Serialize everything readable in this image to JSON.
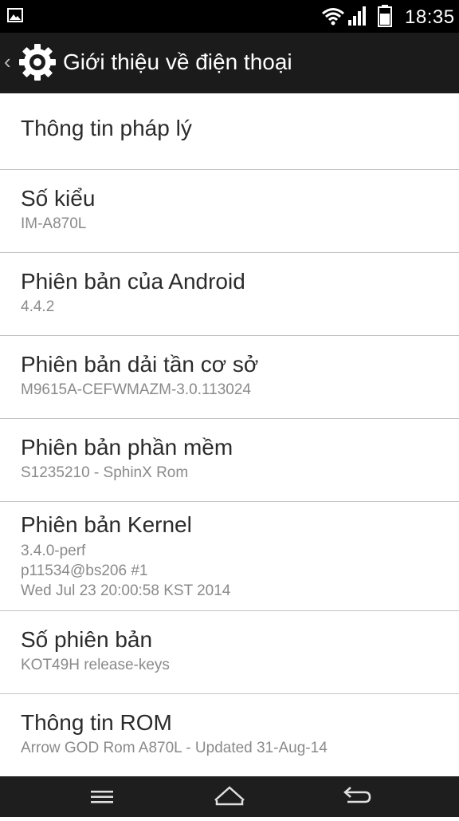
{
  "status_bar": {
    "time": "18:35",
    "icons": [
      "gallery-icon",
      "wifi-icon",
      "signal-icon",
      "battery-icon"
    ]
  },
  "action_bar": {
    "title": "Giới thiệu về điện thoại",
    "icon": "gear-icon"
  },
  "items": [
    {
      "label": "Thông tin pháp lý"
    },
    {
      "label": "Số kiểu",
      "sub": [
        "IM-A870L"
      ]
    },
    {
      "label": "Phiên bản của Android",
      "sub": [
        "4.4.2"
      ]
    },
    {
      "label": "Phiên bản dải tần cơ sở",
      "sub": [
        "M9615A-CEFWMAZM-3.0.113024"
      ]
    },
    {
      "label": "Phiên bản phần mềm",
      "sub": [
        "S1235210 - SphinX Rom"
      ]
    },
    {
      "label": "Phiên bản Kernel",
      "sub": [
        "3.4.0-perf",
        "p11534@bs206 #1",
        "Wed Jul 23 20:00:58 KST 2014"
      ]
    },
    {
      "label": "Số phiên bản",
      "sub": [
        "KOT49H release-keys"
      ]
    },
    {
      "label": "Thông tin ROM",
      "sub": [
        "Arrow GOD Rom A870L - Updated 31-Aug-14"
      ]
    }
  ],
  "nav_bar": {
    "icons": [
      "menu-icon",
      "home-icon",
      "back-icon"
    ]
  },
  "colors": {
    "status_bar": "#000000",
    "action_bar": "#1b1b1b",
    "list_bg": "#ffffff",
    "label": "#2b2b2b",
    "subtext": "#8a8a8a",
    "nav_bar": "#1e1e1e"
  }
}
